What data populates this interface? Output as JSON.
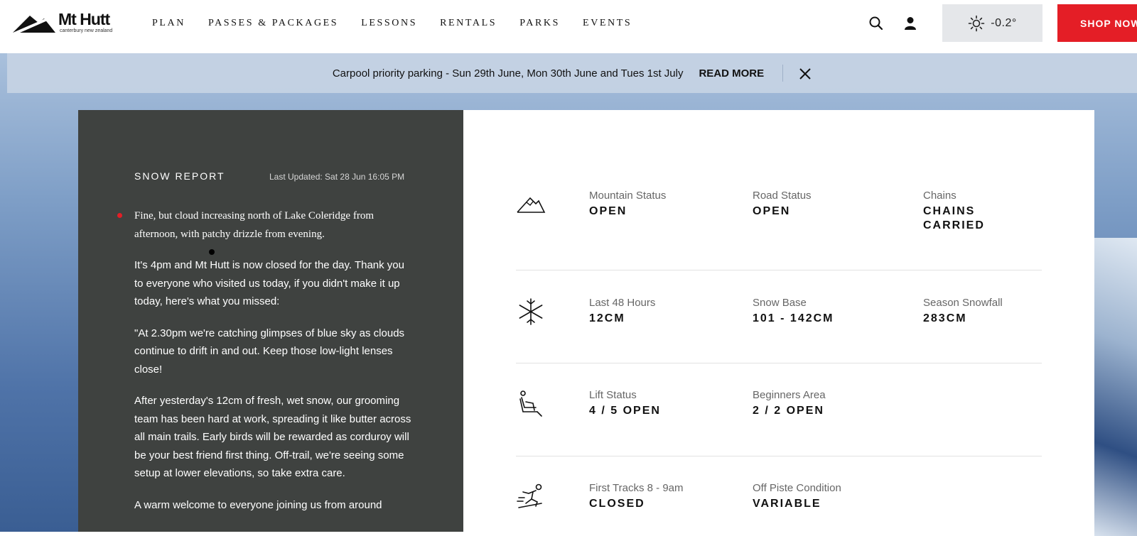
{
  "header": {
    "logo": {
      "brand": "Mt Hutt",
      "subtitle": "canterbury  new zealand"
    },
    "nav": [
      "PLAN",
      "PASSES & PACKAGES",
      "LESSONS",
      "RENTALS",
      "PARKS",
      "EVENTS"
    ],
    "icons": {
      "search": "search-icon",
      "account": "user-icon",
      "weather": "sun-icon"
    },
    "weather_temp": "-0.2°",
    "shop_label": "SHOP NOW",
    "colors": {
      "accent": "#e41e26",
      "weather_bg": "#e5e7ea"
    }
  },
  "banner": {
    "text": "Carpool priority parking - Sun 29th June, Mon 30th June and Tues 1st July",
    "link": "READ MORE",
    "close_icon": "close-icon"
  },
  "report": {
    "title": "SNOW REPORT",
    "last_updated": "Last Updated: Sat 28 Jun 16:05 PM",
    "forecast": "Fine, but cloud increasing north of Lake Coleridge from afternoon, with patchy drizzle from evening.",
    "paragraphs": [
      "It's 4pm and Mt Hutt is now closed for the day. Thank you to everyone who visited us today, if you didn't make it up today, here's what you missed:",
      "\"At 2.30pm we're catching glimpses of blue sky as clouds continue to drift in and out. Keep those low-light lenses close!",
      "After yesterday's 12cm of fresh, wet snow, our grooming team has been hard at work, spreading it like butter across all main trails. Early birds will be rewarded as corduroy will be your best friend first thing. Off-trail, we're seeing some setup at lower elevations, so take extra care.",
      "A warm welcome to everyone joining us from around"
    ]
  },
  "conditions": {
    "mountain": {
      "icon": "mountain-icon",
      "stats": [
        {
          "label": "Mountain Status",
          "value": "OPEN"
        },
        {
          "label": "Road Status",
          "value": "OPEN"
        },
        {
          "label": "Chains",
          "value": "CHAINS CARRIED"
        }
      ]
    },
    "snow": {
      "icon": "snowflake-icon",
      "stats": [
        {
          "label": "Last 48 Hours",
          "value": "12CM"
        },
        {
          "label": "Snow Base",
          "value": "101 - 142CM"
        },
        {
          "label": "Season Snowfall",
          "value": "283CM"
        }
      ]
    },
    "lifts": {
      "icon": "chairlift-icon",
      "stats": [
        {
          "label": "Lift Status",
          "value": "4 / 5 OPEN"
        },
        {
          "label": "Beginners Area",
          "value": "2 / 2 OPEN"
        }
      ]
    },
    "terrain": {
      "icon": "skier-icon",
      "stats": [
        {
          "label": "First Tracks 8 - 9am",
          "value": "CLOSED"
        },
        {
          "label": "Off Piste Condition",
          "value": "VARIABLE"
        }
      ]
    }
  }
}
